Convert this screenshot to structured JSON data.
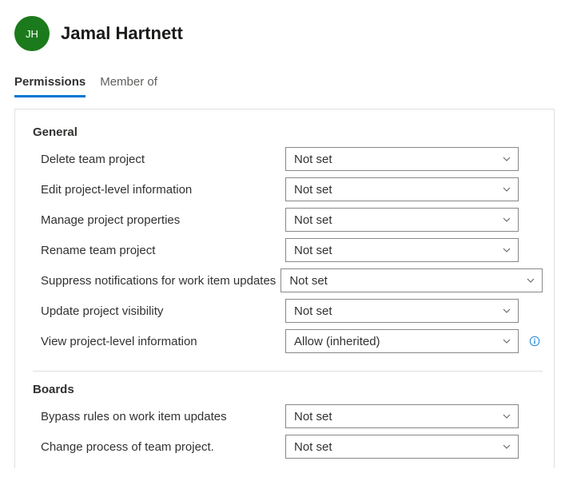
{
  "user": {
    "initials": "JH",
    "name": "Jamal Hartnett"
  },
  "tabs": [
    {
      "label": "Permissions",
      "active": true
    },
    {
      "label": "Member of",
      "active": false
    }
  ],
  "sections": [
    {
      "heading": "General",
      "permissions": [
        {
          "label": "Delete team project",
          "value": "Not set",
          "wide": false,
          "info": false
        },
        {
          "label": "Edit project-level information",
          "value": "Not set",
          "wide": false,
          "info": false
        },
        {
          "label": "Manage project properties",
          "value": "Not set",
          "wide": false,
          "info": false
        },
        {
          "label": "Rename team project",
          "value": "Not set",
          "wide": false,
          "info": false
        },
        {
          "label": "Suppress notifications for work item updates",
          "value": "Not set",
          "wide": true,
          "info": false
        },
        {
          "label": "Update project visibility",
          "value": "Not set",
          "wide": false,
          "info": false
        },
        {
          "label": "View project-level information",
          "value": "Allow (inherited)",
          "wide": false,
          "info": true
        }
      ]
    },
    {
      "heading": "Boards",
      "permissions": [
        {
          "label": "Bypass rules on work item updates",
          "value": "Not set",
          "wide": false,
          "info": false
        },
        {
          "label": "Change process of team project.",
          "value": "Not set",
          "wide": false,
          "info": false
        }
      ]
    }
  ]
}
